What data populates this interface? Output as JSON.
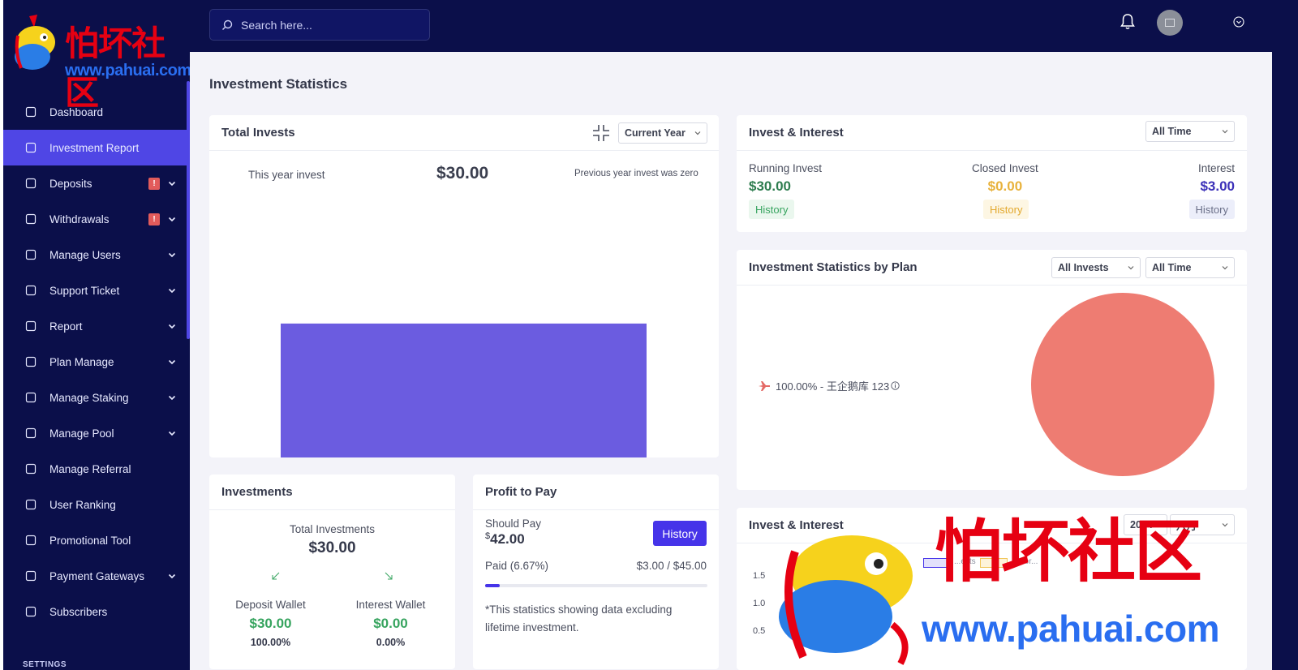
{
  "logo": {
    "title": "怕坏社区",
    "url": "www.pahuai.com"
  },
  "search": {
    "placeholder": "Search here..."
  },
  "sidebar": {
    "items": [
      {
        "label": "Dashboard",
        "icon": "home-icon",
        "active": false,
        "badge": "",
        "caret": false
      },
      {
        "label": "Investment Report",
        "icon": "bar-chart-icon",
        "active": true,
        "badge": "",
        "caret": false
      },
      {
        "label": "Deposits",
        "icon": "deposit-icon",
        "active": false,
        "badge": "!",
        "caret": true
      },
      {
        "label": "Withdrawals",
        "icon": "bank-icon",
        "active": false,
        "badge": "!",
        "caret": true
      },
      {
        "label": "Manage Users",
        "icon": "users-icon",
        "active": false,
        "badge": "",
        "caret": true
      },
      {
        "label": "Support Ticket",
        "icon": "ticket-icon",
        "active": false,
        "badge": "",
        "caret": true
      },
      {
        "label": "Report",
        "icon": "list-icon",
        "active": false,
        "badge": "",
        "caret": true
      },
      {
        "label": "Plan Manage",
        "icon": "clipboard-icon",
        "active": false,
        "badge": "",
        "caret": true
      },
      {
        "label": "Manage Staking",
        "icon": "trend-icon",
        "active": false,
        "badge": "",
        "caret": true
      },
      {
        "label": "Manage Pool",
        "icon": "coins-icon",
        "active": false,
        "badge": "",
        "caret": true
      },
      {
        "label": "Manage Referral",
        "icon": "tree-icon",
        "active": false,
        "badge": "",
        "caret": false
      },
      {
        "label": "User Ranking",
        "icon": "medal-icon",
        "active": false,
        "badge": "",
        "caret": false
      },
      {
        "label": "Promotional Tool",
        "icon": "ad-icon",
        "active": false,
        "badge": "",
        "caret": false
      },
      {
        "label": "Payment Gateways",
        "icon": "card-icon",
        "active": false,
        "badge": "",
        "caret": true
      },
      {
        "label": "Subscribers",
        "icon": "thumbs-up-icon",
        "active": false,
        "badge": "",
        "caret": false
      }
    ],
    "section_label": "SETTINGS"
  },
  "page": {
    "title": "Investment Statistics"
  },
  "total_invests": {
    "title": "Total Invests",
    "period_select": "Current Year",
    "this_year_label": "This year invest",
    "amount": "$30.00",
    "note": "Previous year invest was zero"
  },
  "invest_interest": {
    "title": "Invest & Interest",
    "period_select": "All Time",
    "running": {
      "label": "Running Invest",
      "value": "$30.00",
      "button": "History",
      "color": "#2e9e5a"
    },
    "closed": {
      "label": "Closed Invest",
      "value": "$0.00",
      "button": "History",
      "color": "#e8b23c"
    },
    "interest": {
      "label": "Interest",
      "value": "$3.00",
      "button": "History",
      "color": "#4634c9"
    }
  },
  "stats_by_plan": {
    "title": "Investment Statistics by Plan",
    "plan_select": "All Invests",
    "period_select": "All Time",
    "legend": "100.00% - 王企鹅库 123",
    "pie_color": "#ee7c72"
  },
  "investments": {
    "title": "Investments",
    "total_label": "Total Investments",
    "total_value": "$30.00",
    "deposit_label": "Deposit Wallet",
    "deposit_value": "$30.00",
    "deposit_pct": "100.00%",
    "interest_label": "Interest Wallet",
    "interest_value": "$0.00",
    "interest_pct": "0.00%"
  },
  "profit_to_pay": {
    "title": "Profit to Pay",
    "should_pay_label": "Should Pay",
    "currency": "$",
    "should_pay_value": "42.00",
    "button": "History",
    "paid_label": "Paid (6.67%)",
    "paid_amount": "$3.00 / $45.00",
    "paid_fraction": 0.0667,
    "note": "*This statistics showing data excluding lifetime investment."
  },
  "invest_interest_chart": {
    "title": "Invest & Interest",
    "year_select": "2024",
    "month_select": "八月",
    "legend": [
      "...ests",
      "...nter..."
    ]
  },
  "chart_data": [
    {
      "type": "bar",
      "categories": [
        ""
      ],
      "values": [
        30
      ],
      "title": "Total Invests",
      "color": "#6b5ce0"
    },
    {
      "type": "pie",
      "labels": [
        "王企鹅库 123"
      ],
      "values": [
        100
      ],
      "colors": [
        "#ee7c72"
      ]
    },
    {
      "type": "bar",
      "title": "Invest & Interest",
      "y_ticks": [
        "1.5",
        "1.0",
        "0.5"
      ]
    }
  ]
}
